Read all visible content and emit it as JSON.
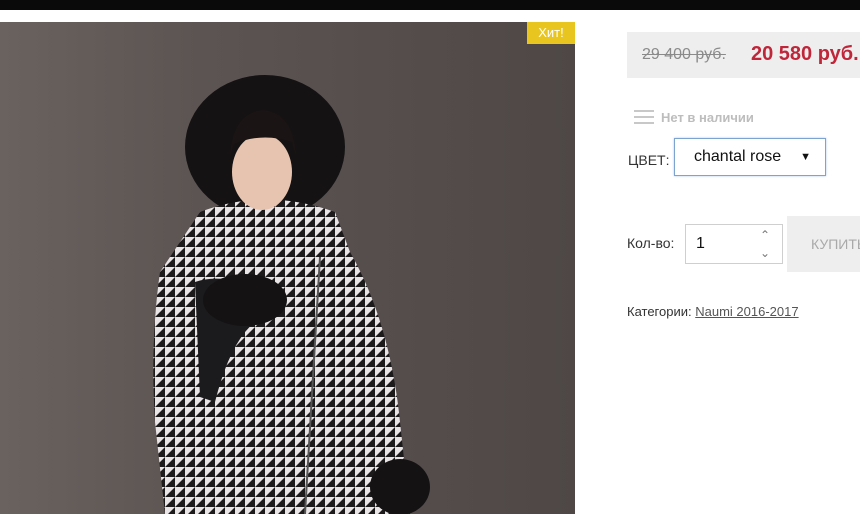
{
  "product": {
    "badge": "Хит!",
    "image_icon": "product-photo-woman-houndstooth-coat"
  },
  "price": {
    "old": "29 400 руб.",
    "new": "20 580 руб."
  },
  "stock": {
    "icon": "menu-icon",
    "text": "Нет в наличии"
  },
  "color": {
    "label": "ЦВЕТ:",
    "selected": "chantal rose",
    "caret": "▼"
  },
  "quantity": {
    "label": "Кол-во:",
    "value": "1"
  },
  "buy": {
    "label": "КУПИТЬ"
  },
  "categories": {
    "label": "Категории:",
    "link": "Naumi 2016-2017"
  },
  "colors": {
    "badge": "#e9c51f",
    "new_price": "#c0263a",
    "price_bg": "#eeeeee",
    "select_border": "#7da3d1"
  }
}
